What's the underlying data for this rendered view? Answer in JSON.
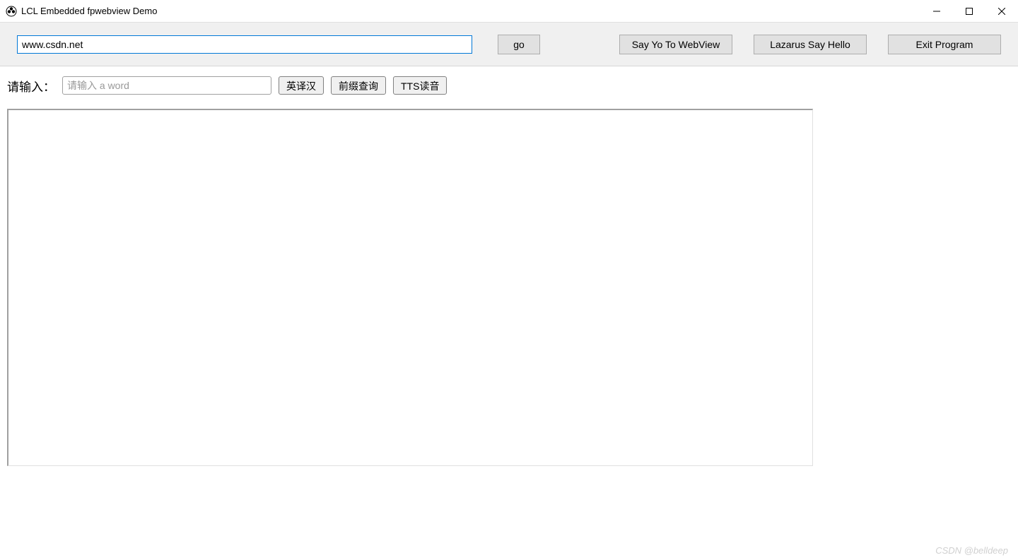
{
  "window": {
    "title": "LCL Embedded fpwebview Demo"
  },
  "toolbar": {
    "url_value": "www.csdn.net",
    "go_label": "go",
    "say_yo_label": "Say Yo To WebView",
    "lazarus_label": "Lazarus Say Hello",
    "exit_label": "Exit Program"
  },
  "content": {
    "input_label": "请输入：",
    "word_placeholder": "请输入 a word",
    "translate_label": "英译汉",
    "prefix_label": "前缀查询",
    "tts_label": "TTS读音"
  },
  "watermark": "CSDN @belldeep"
}
